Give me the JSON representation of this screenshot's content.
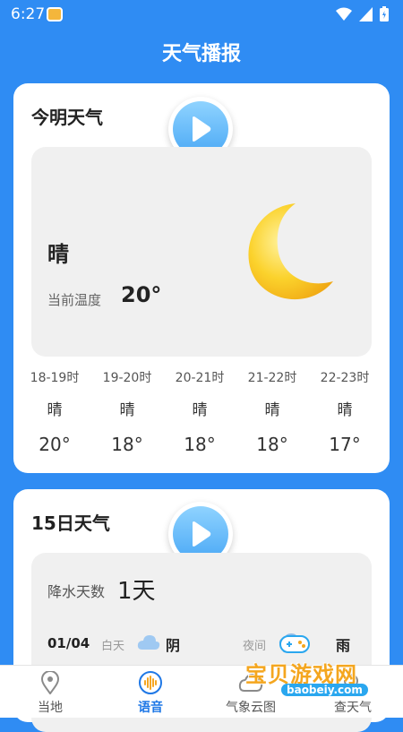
{
  "status_bar": {
    "time": "6:27"
  },
  "header": {
    "title": "天气播报"
  },
  "today_card": {
    "title": "今明天气",
    "condition": "晴",
    "temp_label": "当前温度",
    "temp_value": "20°",
    "hourly": [
      {
        "time": "18-19时",
        "cond": "晴",
        "temp": "20°"
      },
      {
        "time": "19-20时",
        "cond": "晴",
        "temp": "18°"
      },
      {
        "time": "20-21时",
        "cond": "晴",
        "temp": "18°"
      },
      {
        "time": "21-22时",
        "cond": "晴",
        "temp": "18°"
      },
      {
        "time": "22-23时",
        "cond": "晴",
        "temp": "17°"
      }
    ]
  },
  "forecast_card": {
    "title": "15日天气",
    "rain_label": "降水天数",
    "rain_value": "1天",
    "rows": [
      {
        "date": "01/04",
        "day_label": "白天",
        "day_cond": "阴",
        "night_label": "夜间",
        "night_cond": "雨"
      }
    ]
  },
  "bottom_nav": {
    "items": [
      {
        "label": "当地",
        "icon": "location-pin-icon"
      },
      {
        "label": "语音",
        "icon": "voice-wave-icon",
        "active": true
      },
      {
        "label": "气象云图",
        "icon": "cloud-map-icon"
      },
      {
        "label": "查天气",
        "icon": "search-weather-icon"
      }
    ]
  },
  "watermark": {
    "text": "宝贝游戏网",
    "url": "baobeiy.com"
  },
  "colors": {
    "background": "#2f8cf3",
    "accent": "#1f78e6",
    "moon": "#f9c61f"
  }
}
